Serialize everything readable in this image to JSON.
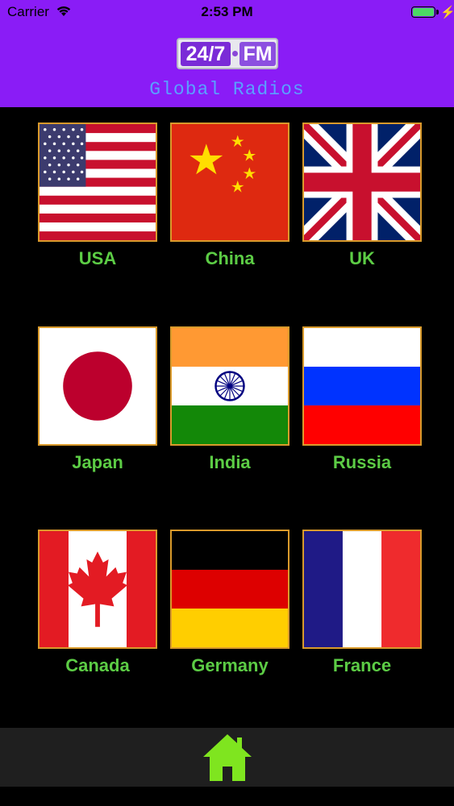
{
  "status_bar": {
    "carrier": "Carrier",
    "time": "2:53 PM"
  },
  "header": {
    "logo_part1": "24/7",
    "logo_part2": "FM",
    "subtitle": "Global Radios",
    "background_color": "#8a1cf6"
  },
  "countries": [
    {
      "label": "USA"
    },
    {
      "label": "China"
    },
    {
      "label": "UK"
    },
    {
      "label": "Japan"
    },
    {
      "label": "India"
    },
    {
      "label": "Russia"
    },
    {
      "label": "Canada"
    },
    {
      "label": "Germany"
    },
    {
      "label": "France"
    }
  ],
  "footer": {
    "icon": "home-icon",
    "icon_color": "#7fe51f"
  },
  "colors": {
    "label": "#5ccc45",
    "flag_border": "#d99a2b"
  }
}
